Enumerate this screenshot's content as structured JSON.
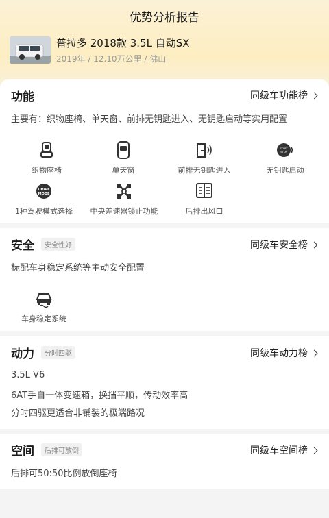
{
  "header": {
    "title": "优势分析报告"
  },
  "car": {
    "name": "普拉多 2018款 3.5L 自动SX",
    "meta": "2019年 / 12.10万公里 / 佛山"
  },
  "function": {
    "title": "功能",
    "link": "同级车功能榜",
    "summary": "主要有：织物座椅、单天窗、前排无钥匙进入、无钥匙启动等实用配置",
    "items": [
      {
        "label": "织物座椅",
        "icon": "seat-icon"
      },
      {
        "label": "单天窗",
        "icon": "sunroof-icon"
      },
      {
        "label": "前排无钥匙进入",
        "icon": "keyless-entry-icon"
      },
      {
        "label": "无钥匙启动",
        "icon": "start-stop-icon"
      },
      {
        "label": "1种驾驶模式选择",
        "icon": "drive-mode-icon"
      },
      {
        "label": "中央差速器锁止功能",
        "icon": "diff-lock-icon"
      },
      {
        "label": "后排出风口",
        "icon": "rear-vent-icon"
      }
    ],
    "icon_texts": {
      "drive_mode": "DRIVE MODE",
      "start_stop": "START STOP"
    }
  },
  "safety": {
    "title": "安全",
    "tag": "安全性好",
    "link": "同级车安全榜",
    "summary": "标配车身稳定系统等主动安全配置",
    "items": [
      {
        "label": "车身稳定系统",
        "icon": "stability-control-icon"
      }
    ]
  },
  "power": {
    "title": "动力",
    "tag": "分时四驱",
    "link": "同级车动力榜",
    "lines": [
      "3.5L V6",
      "6AT手自一体变速箱，换挡平顺，传动效率高",
      "分时四驱更适合非铺装的极端路况"
    ]
  },
  "space": {
    "title": "空间",
    "tag": "后排可放倒",
    "link": "同级车空间榜",
    "summary": "后排可50:50比例放倒座椅"
  },
  "colors": {
    "accent_bg": "#fdeec2",
    "text": "#222222",
    "muted": "#9a9a9a"
  }
}
